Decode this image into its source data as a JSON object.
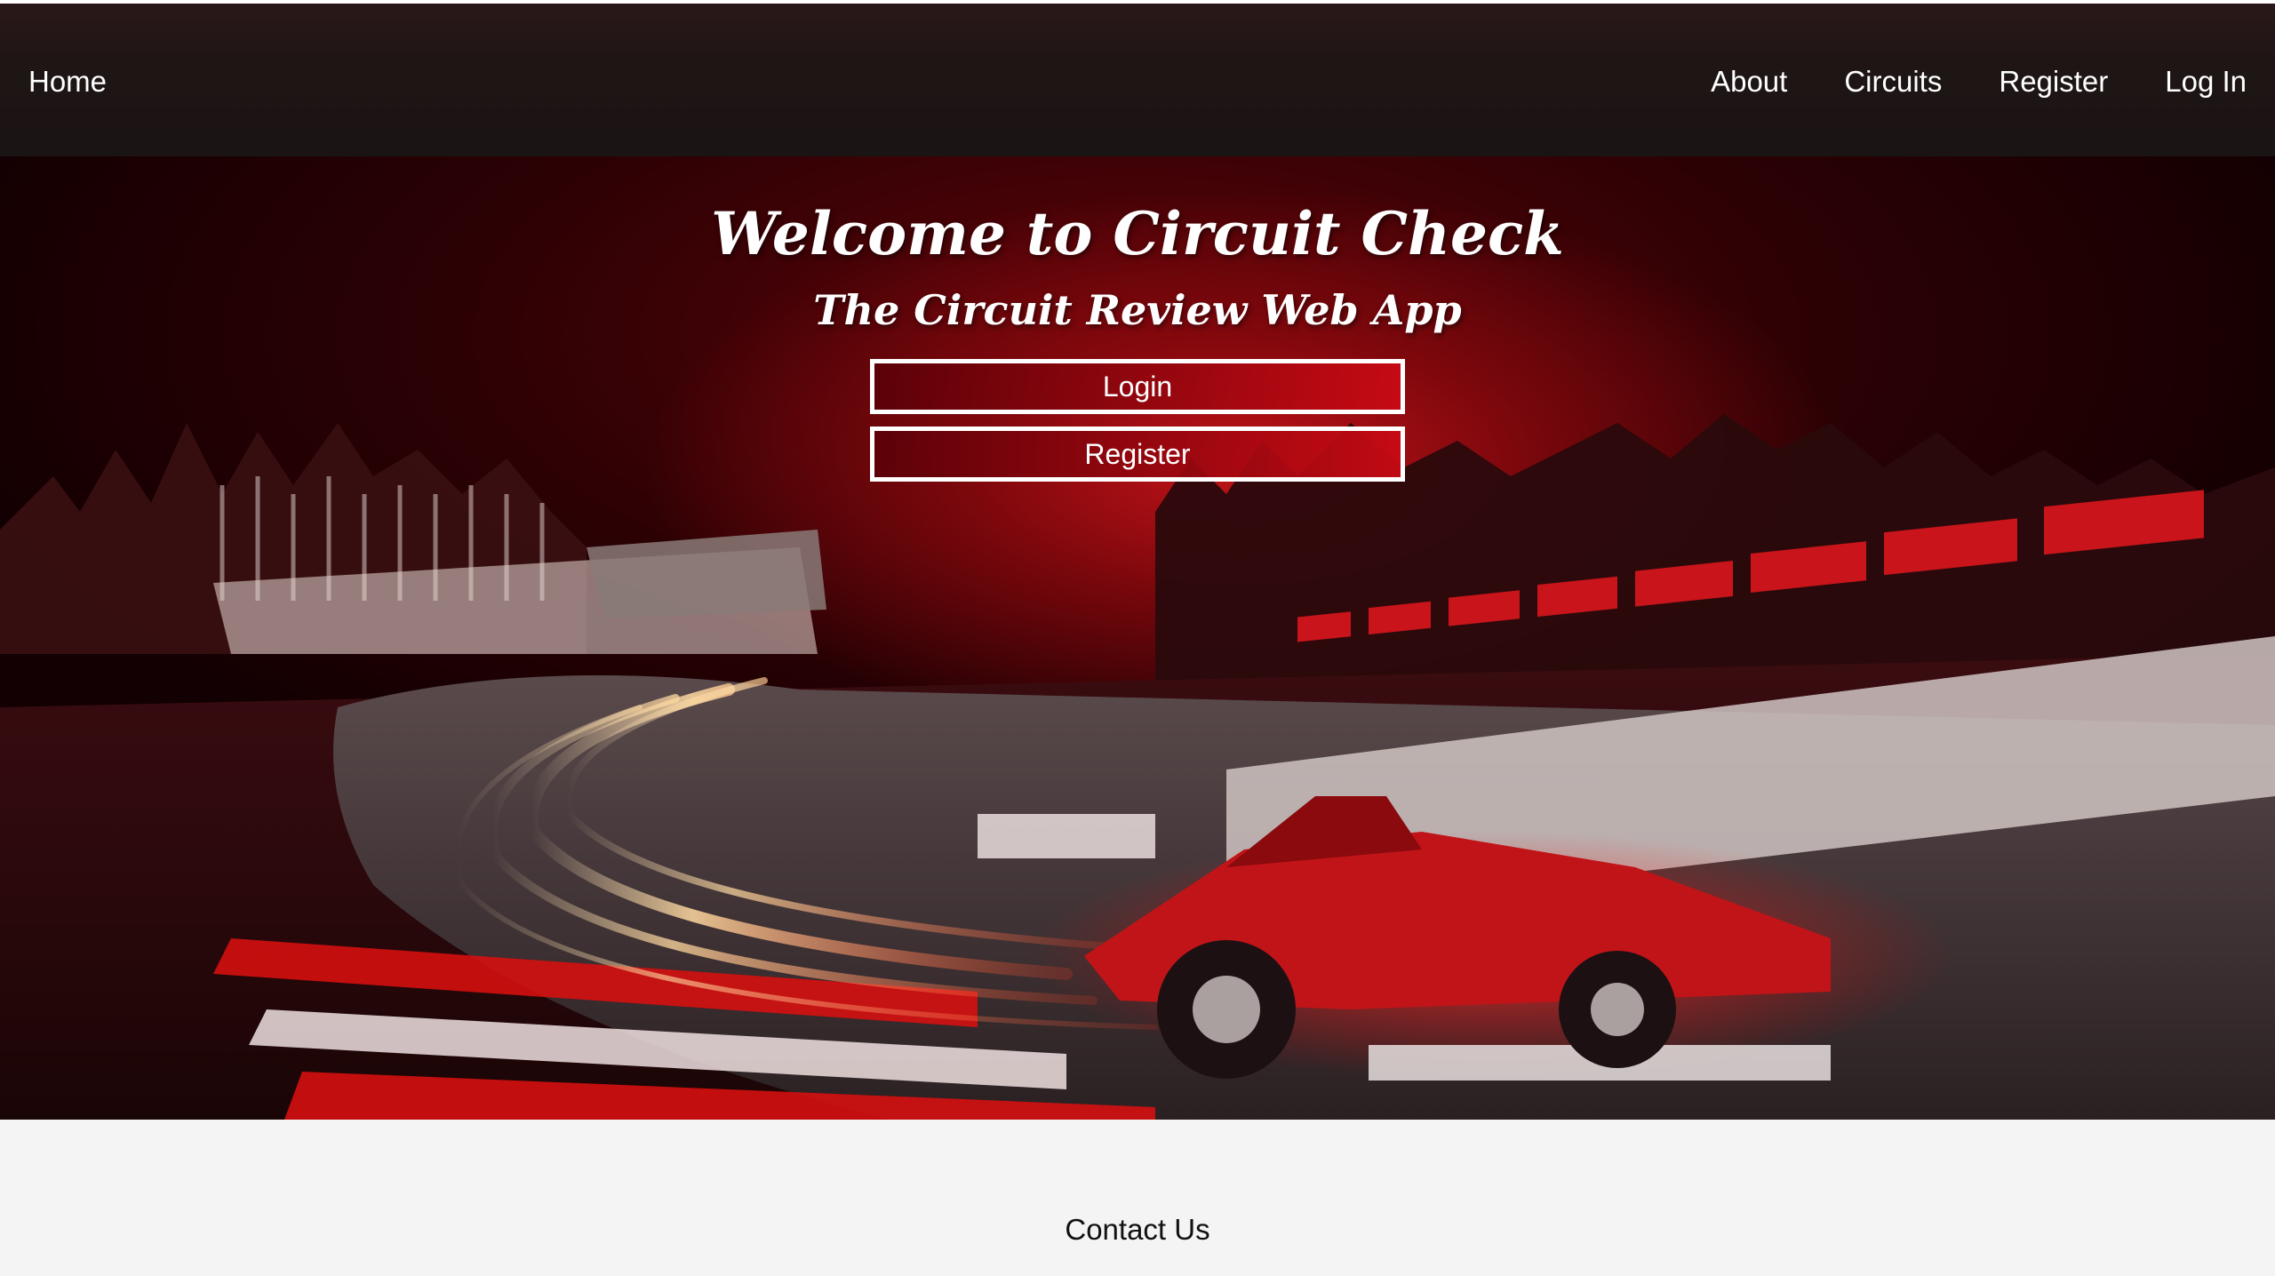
{
  "nav": {
    "home": "Home",
    "links": [
      "About",
      "Circuits",
      "Register",
      "Log In"
    ]
  },
  "hero": {
    "title": "Welcome to Circuit Check",
    "subtitle": "The Circuit Review Web App",
    "login_label": "Login",
    "register_label": "Register",
    "background_icon": "racing-car-image"
  },
  "footer": {
    "contact": "Contact Us"
  },
  "colors": {
    "navbar": "#1f1515",
    "accent_red": "#c8141a",
    "footer_bg": "#f4f4f4",
    "text_light": "#ffffff"
  }
}
